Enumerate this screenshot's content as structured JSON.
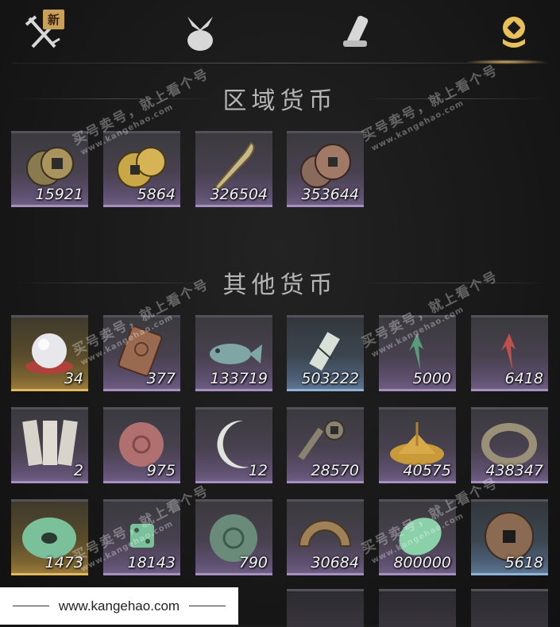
{
  "tabs": [
    {
      "name": "sword-tab",
      "badge": "新"
    },
    {
      "name": "bundle-tab"
    },
    {
      "name": "scroll-tab"
    },
    {
      "name": "currency-tab",
      "active": true
    }
  ],
  "sections": {
    "regional": {
      "title": "区域货币"
    },
    "other": {
      "title": "其他货币"
    }
  },
  "regional_items": [
    {
      "icon": "copper-coins-icon",
      "count": "15921",
      "rarity": "purple"
    },
    {
      "icon": "gold-coins-icon",
      "count": "5864",
      "rarity": "purple"
    },
    {
      "icon": "feather-blade-icon",
      "count": "326504",
      "rarity": "purple"
    },
    {
      "icon": "bronze-coins-icon",
      "count": "353644",
      "rarity": "purple"
    }
  ],
  "other_items": [
    {
      "icon": "pearl-icon",
      "count": "34",
      "rarity": "gold"
    },
    {
      "icon": "bronze-tablet-icon",
      "count": "377",
      "rarity": "purple"
    },
    {
      "icon": "jade-fish-icon",
      "count": "133719",
      "rarity": "purple"
    },
    {
      "icon": "talisman-icon",
      "count": "503222",
      "rarity": "blue"
    },
    {
      "icon": "green-flame-icon",
      "count": "5000",
      "rarity": "purple"
    },
    {
      "icon": "red-flame-icon",
      "count": "6418",
      "rarity": "purple"
    },
    {
      "icon": "paper-slips-icon",
      "count": "2",
      "rarity": "purple"
    },
    {
      "icon": "rose-stone-icon",
      "count": "975",
      "rarity": "purple"
    },
    {
      "icon": "moon-jade-icon",
      "count": "12",
      "rarity": "purple"
    },
    {
      "icon": "key-coin-icon",
      "count": "28570",
      "rarity": "purple"
    },
    {
      "icon": "grain-pile-icon",
      "count": "40575",
      "rarity": "purple"
    },
    {
      "icon": "bracelet-icon",
      "count": "438347",
      "rarity": "purple"
    },
    {
      "icon": "jade-ring-icon",
      "count": "1473",
      "rarity": "gold"
    },
    {
      "icon": "jade-dice-icon",
      "count": "18143",
      "rarity": "purple"
    },
    {
      "icon": "jade-disc-icon",
      "count": "790",
      "rarity": "purple"
    },
    {
      "icon": "bronze-half-icon",
      "count": "30684",
      "rarity": "purple"
    },
    {
      "icon": "jade-stone-icon",
      "count": "800000",
      "rarity": "purple"
    },
    {
      "icon": "square-hole-coin-icon",
      "count": "5618",
      "rarity": "blue"
    }
  ],
  "watermark": {
    "line1": "买号卖号，就上看个号",
    "line2": "看个号",
    "url": "www.kangehao.com"
  },
  "footer": {
    "text": "www.kangehao.com"
  },
  "colors": {
    "accent": "#c9a058",
    "purple_edge": "#a590c0",
    "gold_edge": "#e0b860",
    "blue_edge": "#8fb3d8"
  }
}
